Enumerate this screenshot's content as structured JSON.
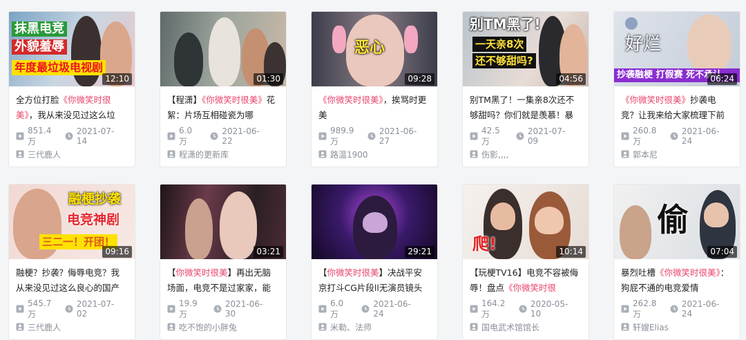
{
  "colors": {
    "accent_pink": "#e8456b",
    "meta_gray": "#8a8f99",
    "title_text": "#222222"
  },
  "videos": [
    {
      "thumb_caption": [
        "抹黑电竞",
        "外貌羞辱",
        "年度最垃圾电视剧"
      ],
      "duration": "12:10",
      "title_parts": [
        {
          "text": "全方位打脸",
          "highlight": false
        },
        {
          "text": "《你微笑时很美》",
          "highlight": true
        },
        {
          "text": "，我从来没见过这么垃",
          "highlight": false
        }
      ],
      "views": "851.4万",
      "date": "2021-07-14",
      "author": "三代鹿人"
    },
    {
      "thumb_caption": [],
      "duration": "01:30",
      "title_parts": [
        {
          "text": "【程潇】",
          "highlight": false
        },
        {
          "text": "《你微笑时很美》",
          "highlight": true
        },
        {
          "text": "花絮：片场互相碰瓷为哪",
          "highlight": false
        }
      ],
      "views": "6.0万",
      "date": "2021-06-22",
      "author": "程潇的更新库"
    },
    {
      "thumb_caption": [
        "恶心"
      ],
      "duration": "09:28",
      "title_parts": [
        {
          "text": "《你微笑时很美》",
          "highlight": true
        },
        {
          "text": "，挨骂时更美",
          "highlight": false
        }
      ],
      "views": "989.9万",
      "date": "2021-06-27",
      "author": "路温1900"
    },
    {
      "thumb_caption": [
        "别TM黑了!",
        "一天亲8次",
        "还不够甜吗?"
      ],
      "duration": "04:56",
      "title_parts": [
        {
          "text": "别TM黑了！一集亲8次还不够甜吗？你们就是羡慕！暴",
          "highlight": false
        }
      ],
      "views": "42.5万",
      "date": "2021-07-09",
      "author": "伤影,,,,"
    },
    {
      "thumb_caption": [
        "好烂",
        "抄袭融梗 打假赛 死不承认"
      ],
      "duration": "06:24",
      "title_parts": [
        {
          "text": "《你微笑时很美》",
          "highlight": true
        },
        {
          "text": "抄袭电竞？让我来给大家梳理下前",
          "highlight": false
        }
      ],
      "views": "260.8万",
      "date": "2021-06-24",
      "author": "郭本尼"
    },
    {
      "thumb_caption": [
        "融梗抄袭",
        "电竞神剧",
        "三二一！开团！"
      ],
      "duration": "09:16",
      "title_parts": [
        {
          "text": "融梗？抄袭？侮辱电竞？我从来没见过这么良心的国产",
          "highlight": false
        }
      ],
      "views": "545.7万",
      "date": "2021-07-02",
      "author": "三代鹿人"
    },
    {
      "thumb_caption": [],
      "duration": "03:21",
      "title_parts": [
        {
          "text": "【",
          "highlight": false
        },
        {
          "text": "你微笑时很美",
          "highlight": true
        },
        {
          "text": "】再出无脑场面，电竞不是过家家，能",
          "highlight": false
        }
      ],
      "views": "19.9万",
      "date": "2021-06-30",
      "author": "吃不饱的小胖兔"
    },
    {
      "thumb_caption": [],
      "duration": "29:21",
      "title_parts": [
        {
          "text": "【",
          "highlight": false
        },
        {
          "text": "你微笑时很美",
          "highlight": true
        },
        {
          "text": "】决战平安京打斗CG片段ll无演员镜头",
          "highlight": false
        }
      ],
      "views": "6.0万",
      "date": "2021-06-24",
      "author": "米勒、法师"
    },
    {
      "thumb_caption": [
        "爬!"
      ],
      "duration": "10:14",
      "title_parts": [
        {
          "text": "【玩梗TV16】电竞不容被侮辱！盘点",
          "highlight": false
        },
        {
          "text": "《你微笑时很",
          "highlight": true
        }
      ],
      "views": "164.2万",
      "date": "2020-05-10",
      "author": "国电武术馆馆长"
    },
    {
      "thumb_caption": [
        "偷"
      ],
      "duration": "07:04",
      "title_parts": [
        {
          "text": "暴烈吐槽",
          "highlight": false
        },
        {
          "text": "《你微笑时很美》",
          "highlight": true
        },
        {
          "text": "：狗屁不通的电竞爱情",
          "highlight": false
        }
      ],
      "views": "262.8万",
      "date": "2021-06-24",
      "author": "轩嫂Elias"
    }
  ]
}
